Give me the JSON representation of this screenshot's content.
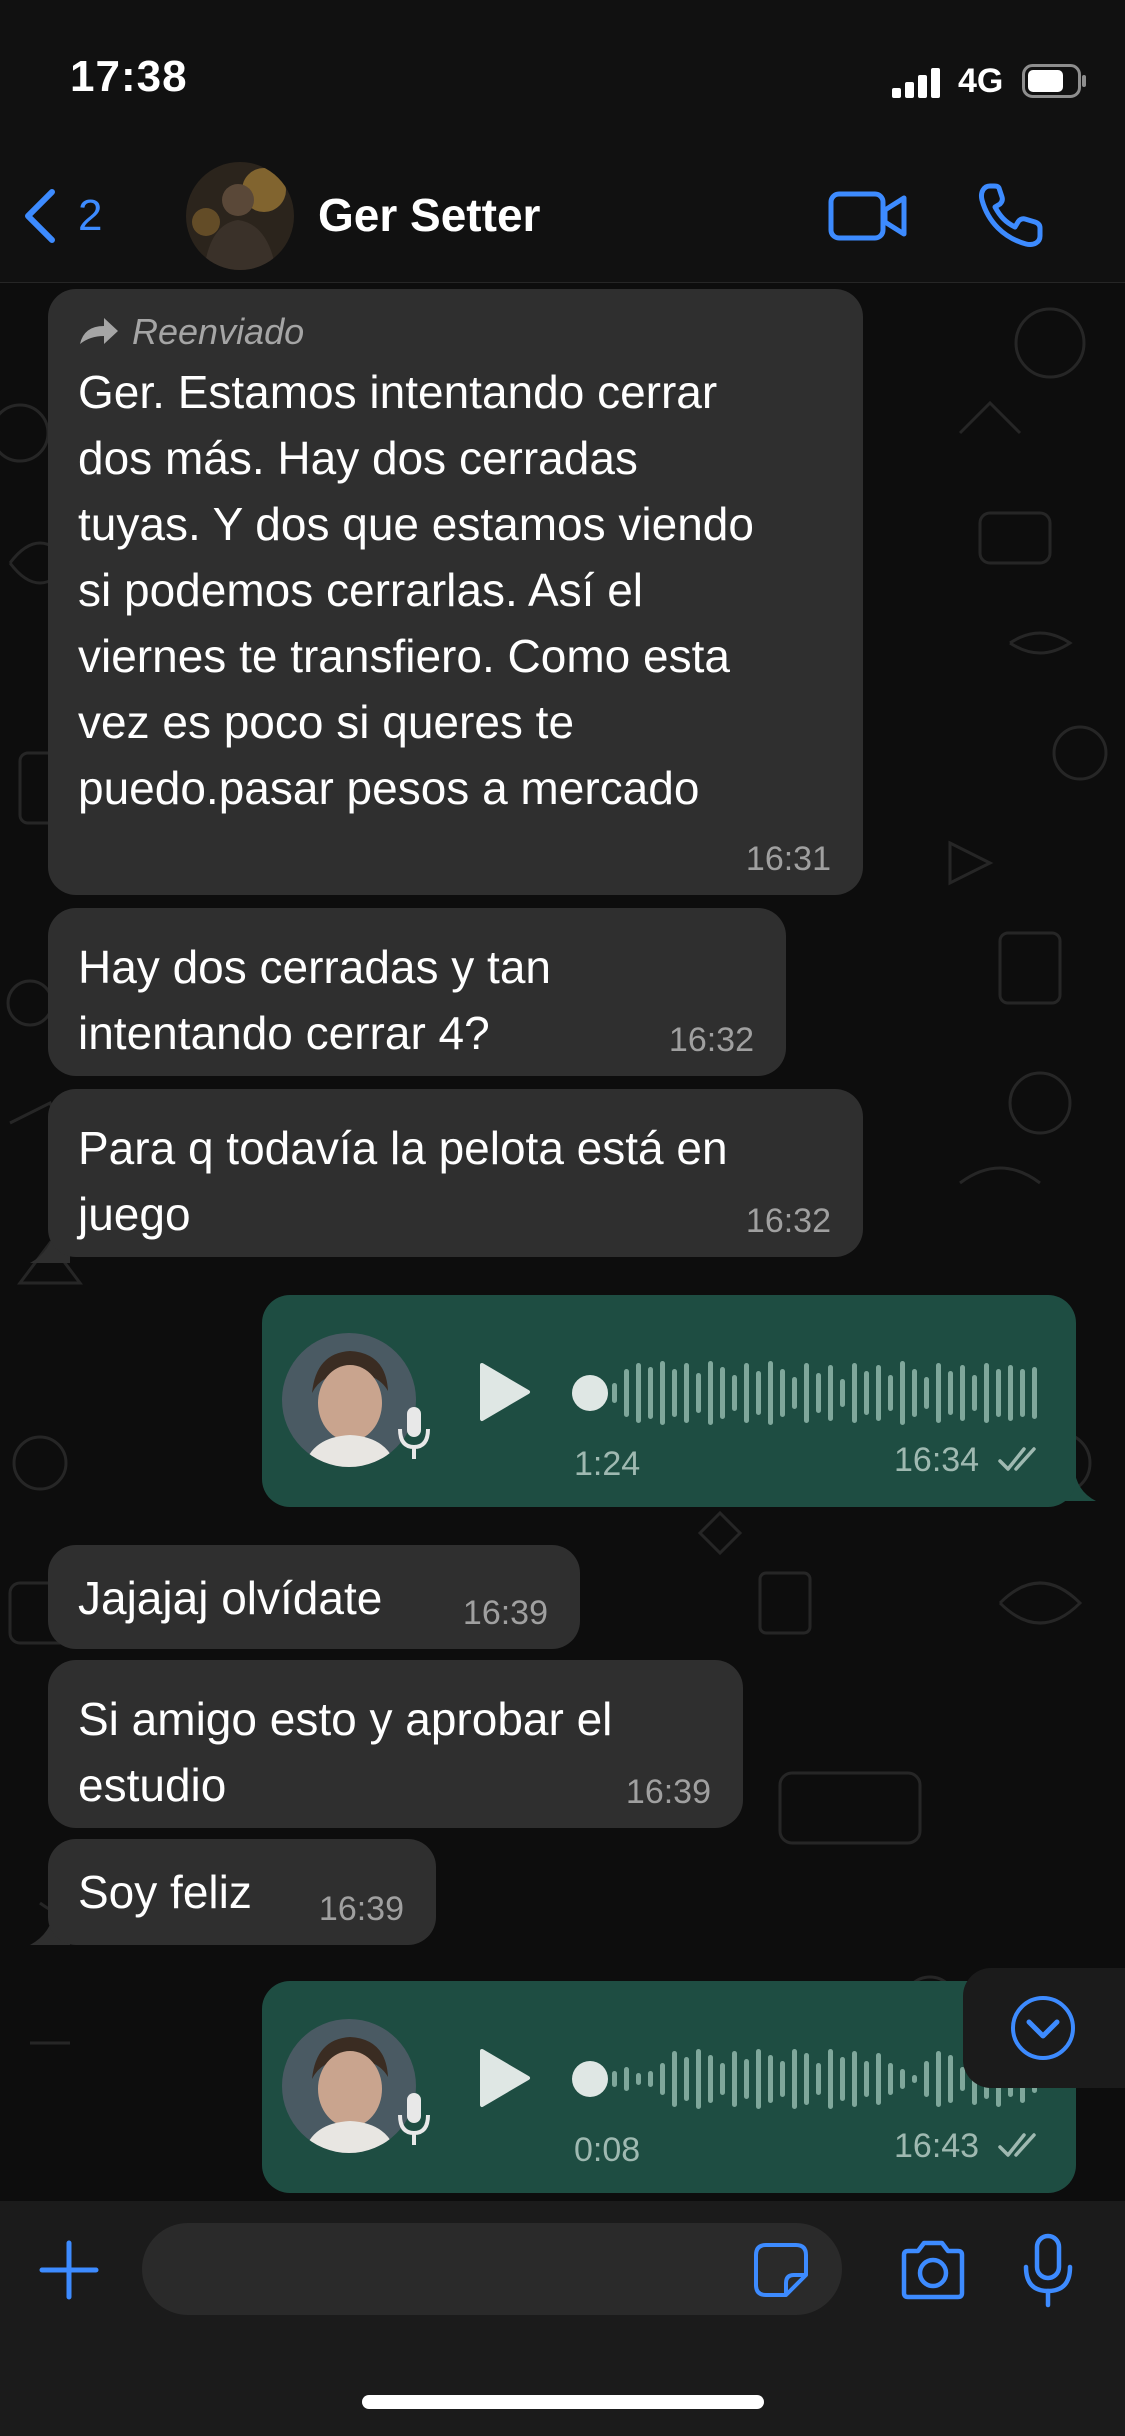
{
  "status_bar": {
    "time": "17:38",
    "network": "4G"
  },
  "header": {
    "back_count": "2",
    "contact_name": "Ger Setter"
  },
  "messages": [
    {
      "forwarded_label": "Reenviado",
      "lines": [
        "Ger. Estamos intentando cerrar",
        "dos más. Hay dos cerradas",
        "tuyas. Y dos que estamos viendo",
        "si podemos cerrarlas. Así el",
        "viernes te transfiero. Como esta",
        "vez es poco si queres te",
        "puedo.pasar pesos a mercado"
      ],
      "time": "16:31"
    },
    {
      "lines": [
        "Hay dos cerradas y tan",
        "intentando cerrar 4?"
      ],
      "time": "16:32"
    },
    {
      "lines": [
        "Para q todavía la pelota está en",
        "juego"
      ],
      "time": "16:32"
    },
    {
      "voice": true,
      "duration": "1:24",
      "time": "16:34"
    },
    {
      "lines": [
        "Jajajaj olvídate"
      ],
      "time": "16:39"
    },
    {
      "lines": [
        "Si amigo esto y aprobar el",
        "estudio"
      ],
      "time": "16:39"
    },
    {
      "lines": [
        "Soy feliz"
      ],
      "time": "16:39"
    },
    {
      "voice": true,
      "duration": "0:08",
      "time": "16:43"
    }
  ],
  "icons": {
    "back": "chevron-left-icon",
    "video": "video-camera-icon",
    "call": "phone-icon",
    "forward": "forward-arrow-icon",
    "play": "play-icon",
    "mic": "microphone-icon",
    "read": "double-check-icon",
    "scroll": "chevron-down-circle-icon",
    "plus": "plus-icon",
    "sticker": "sticker-icon",
    "camera": "camera-icon"
  },
  "colors": {
    "accent": "#3d8bff",
    "incoming_bubble": "#2f2f2f",
    "outgoing_bubble": "#1e4d42",
    "background": "#0b0b0b"
  }
}
